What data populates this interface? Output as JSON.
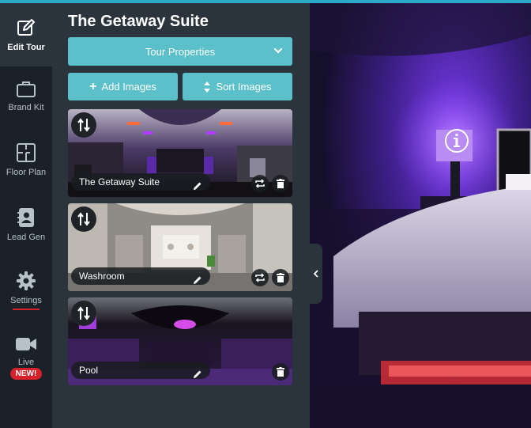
{
  "rail": {
    "items": [
      {
        "label": "Edit Tour",
        "icon": "edit-icon"
      },
      {
        "label": "Brand Kit",
        "icon": "briefcase-icon"
      },
      {
        "label": "Floor Plan",
        "icon": "floor-plan-icon"
      },
      {
        "label": "Lead Gen",
        "icon": "contact-book-icon"
      },
      {
        "label": "Settings",
        "icon": "gear-icon"
      },
      {
        "label": "Live",
        "icon": "video-camera-icon",
        "badge": "NEW!"
      }
    ]
  },
  "panel": {
    "title": "The Getaway Suite",
    "tour_properties_label": "Tour Properties",
    "add_images_label": "Add Images",
    "sort_images_label": "Sort Images"
  },
  "scenes": [
    {
      "name": "The Getaway Suite"
    },
    {
      "name": "Washroom"
    },
    {
      "name": "Pool"
    }
  ],
  "colors": {
    "accent": "#5bc0c9",
    "sidebar": "#1a2128",
    "panel": "#2b343c",
    "alert": "#d6212a"
  }
}
